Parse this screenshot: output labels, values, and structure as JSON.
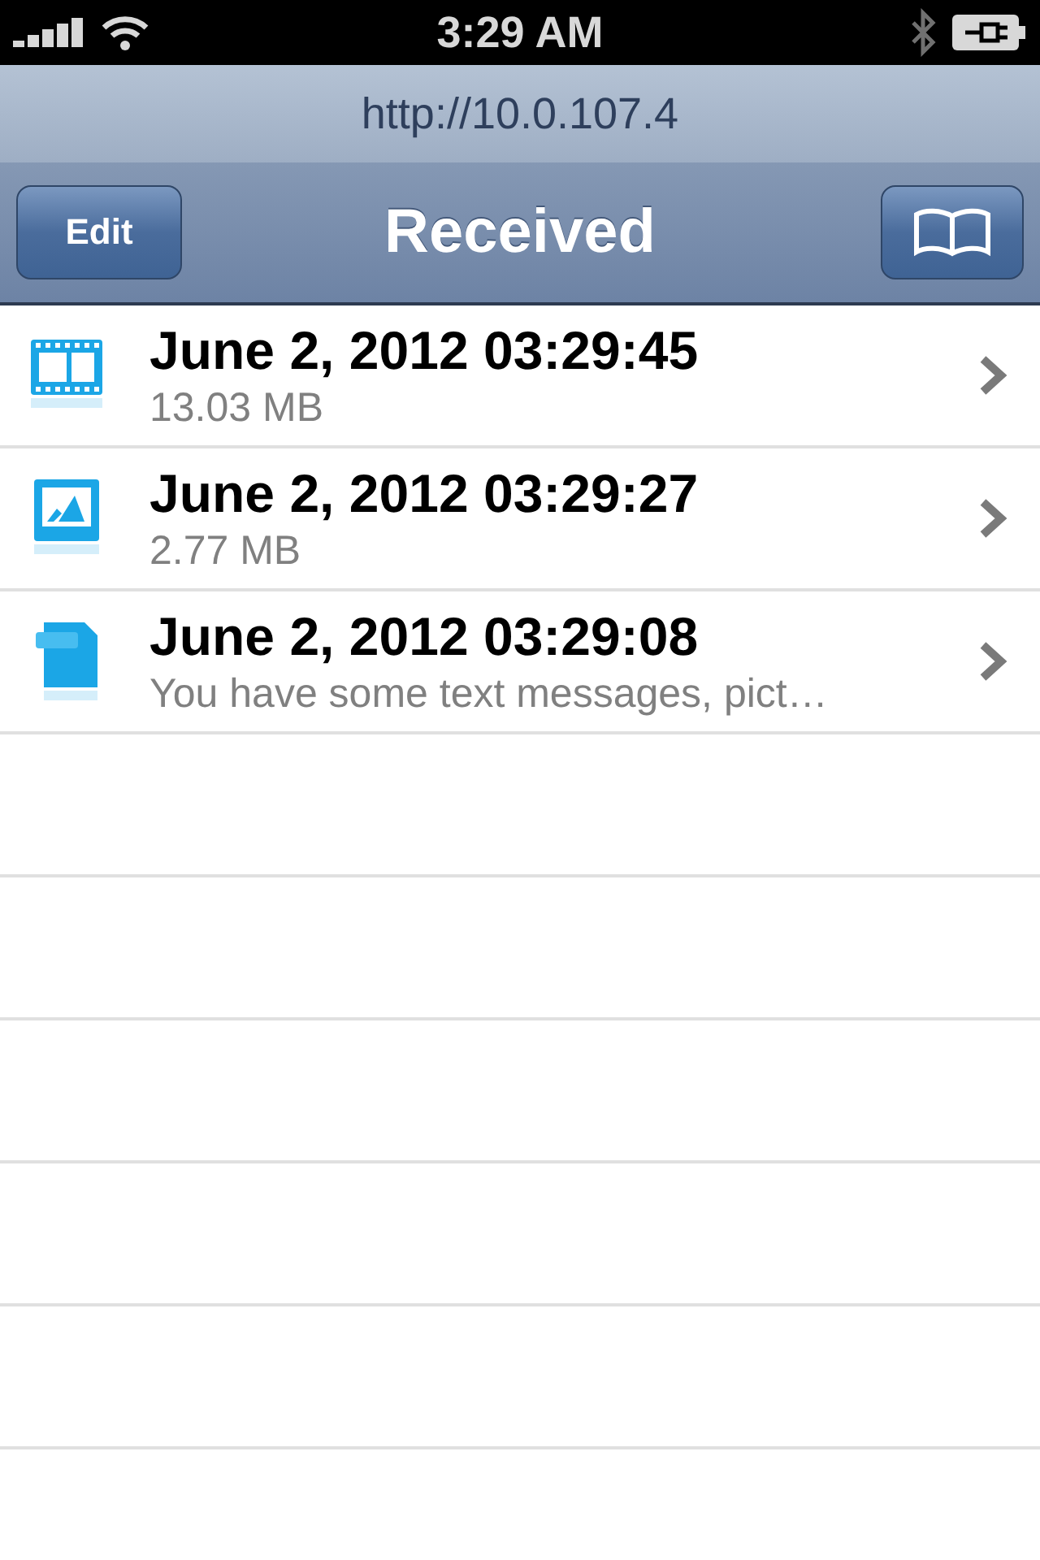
{
  "status_bar": {
    "time": "3:29 AM"
  },
  "address": {
    "url": "http://10.0.107.4"
  },
  "nav_bar": {
    "title": "Received",
    "left_button": "Edit"
  },
  "items": [
    {
      "kind": "video",
      "title": "June 2, 2012 03:29:45",
      "subtitle": "13.03 MB"
    },
    {
      "kind": "image",
      "title": "June 2, 2012 03:29:27",
      "subtitle": "2.77 MB"
    },
    {
      "kind": "document",
      "title": "June 2, 2012 03:29:08",
      "subtitle": "You have some text messages, pict…"
    }
  ]
}
